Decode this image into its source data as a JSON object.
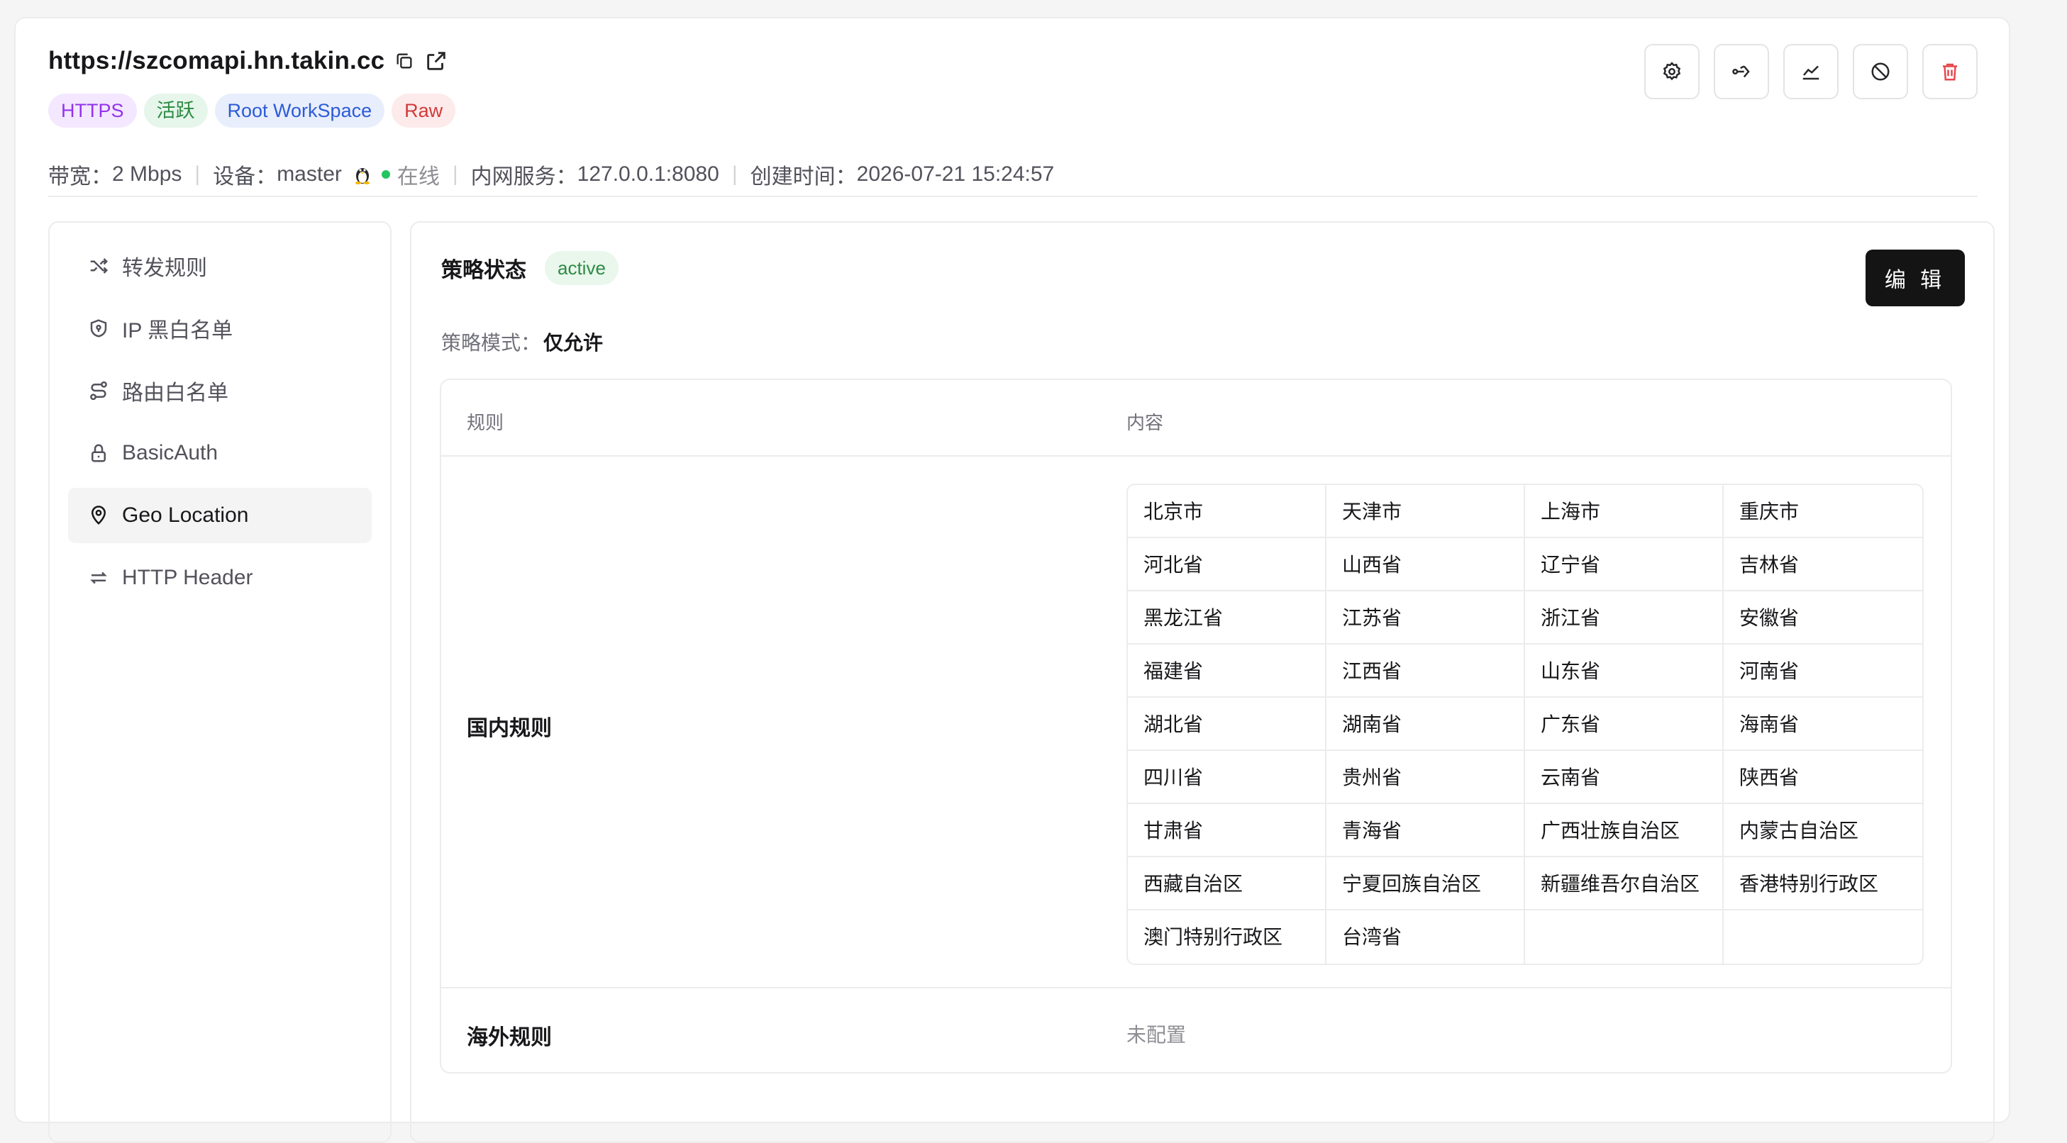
{
  "header": {
    "domain": "https://szcomapi.hn.takin.cc",
    "badges": [
      {
        "label": "HTTPS",
        "bg": "#f3e8ff",
        "fg": "#9333ea"
      },
      {
        "label": "活跃",
        "bg": "#e6f6ea",
        "fg": "#2e8b45"
      },
      {
        "label": "Root WorkSpace",
        "bg": "#e8eefc",
        "fg": "#2d5bd8"
      },
      {
        "label": "Raw",
        "bg": "#fdeaea",
        "fg": "#d23b3b"
      }
    ],
    "meta": {
      "bandwidth_label": "带宽：",
      "bandwidth_value": "2 Mbps",
      "device_label": "设备：",
      "device_value": "master",
      "os_icon": "linux-icon",
      "online_text": "在线",
      "online_color": "#22c55e",
      "service_label": "内网服务：",
      "service_value": "127.0.0.1:8080",
      "created_label": "创建时间：",
      "created_value": "2026-07-21 15:24:57"
    },
    "actions": [
      "gear-icon",
      "share-icon",
      "chart-icon",
      "ban-icon",
      "trash-icon"
    ]
  },
  "sidebar": {
    "items": [
      {
        "label": "转发规则",
        "icon": "shuffle-icon"
      },
      {
        "label": "IP 黑白名单",
        "icon": "shield-icon"
      },
      {
        "label": "路由白名单",
        "icon": "route-icon"
      },
      {
        "label": "BasicAuth",
        "icon": "lock-icon"
      },
      {
        "label": "Geo Location",
        "icon": "map-pin-icon",
        "active": true
      },
      {
        "label": "HTTP Header",
        "icon": "arrows-icon"
      }
    ]
  },
  "policy": {
    "status_label": "策略状态",
    "status_value": "active",
    "edit_label": "编 辑",
    "mode_label": "策略模式：",
    "mode_value": "仅允许",
    "table": {
      "col_rule": "规则",
      "col_content": "内容",
      "domestic_label": "国内规则",
      "regions": [
        "北京市",
        "天津市",
        "上海市",
        "重庆市",
        "河北省",
        "山西省",
        "辽宁省",
        "吉林省",
        "黑龙江省",
        "江苏省",
        "浙江省",
        "安徽省",
        "福建省",
        "江西省",
        "山东省",
        "河南省",
        "湖北省",
        "湖南省",
        "广东省",
        "海南省",
        "四川省",
        "贵州省",
        "云南省",
        "陕西省",
        "甘肃省",
        "青海省",
        "广西壮族自治区",
        "内蒙古自治区",
        "西藏自治区",
        "宁夏回族自治区",
        "新疆维吾尔自治区",
        "香港特别行政区",
        "澳门特别行政区",
        "台湾省"
      ],
      "overseas_label": "海外规则",
      "overseas_value": "未配置"
    }
  },
  "colors": {
    "edit_button": "#141414",
    "danger": "#e5484d",
    "active_badge_bg": "#e9f7ec",
    "active_badge_fg": "#2e8b45"
  }
}
